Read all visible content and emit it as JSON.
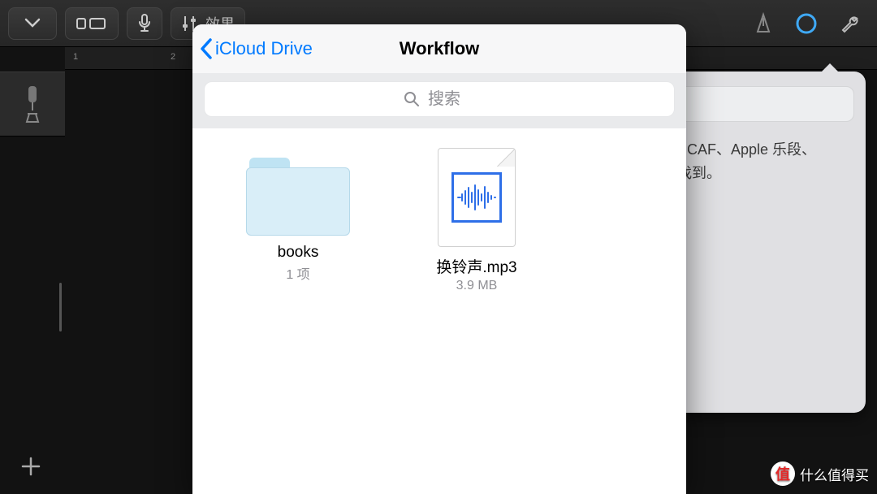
{
  "garageband": {
    "fx_label": "效果",
    "ruler": {
      "mark1": "1",
      "mark2": "2"
    }
  },
  "help_panel": {
    "line1": "V、CAF、Apple 乐段、",
    "line2": "里找到。"
  },
  "picker": {
    "back_label": "iCloud Drive",
    "title": "Workflow",
    "search_placeholder": "搜索",
    "items": [
      {
        "kind": "folder",
        "name": "books",
        "subtitle": "1 项"
      },
      {
        "kind": "audio",
        "name": "换铃声.mp3",
        "subtitle": "3.9 MB"
      }
    ]
  },
  "watermark": {
    "badge": "值",
    "text": "什么值得买"
  }
}
